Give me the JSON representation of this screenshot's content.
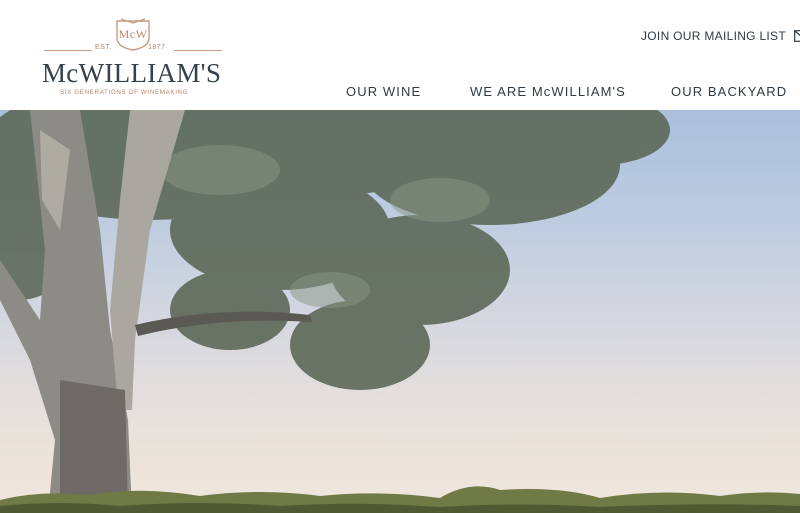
{
  "brand": {
    "monogram": "McW",
    "est_label": "EST.",
    "est_year": "1877",
    "name": "McWILLIAM'S",
    "tagline": "SIX GENERATIONS OF WINEMAKING",
    "accent_color": "#b8876d",
    "text_color": "#35424b"
  },
  "header": {
    "mailing_list": {
      "label": "JOIN OUR MAILING LIST",
      "icon": "mail-icon"
    }
  },
  "nav": {
    "items": [
      {
        "label": "OUR WINE"
      },
      {
        "label": "WE ARE McWILLIAM'S"
      },
      {
        "label": "OUR BACKYARD"
      }
    ]
  },
  "hero": {
    "image": "eucalyptus-tree-over-vineyard",
    "sky_top_color": "#a9bfdc",
    "sky_bottom_color": "#efe6dc"
  }
}
